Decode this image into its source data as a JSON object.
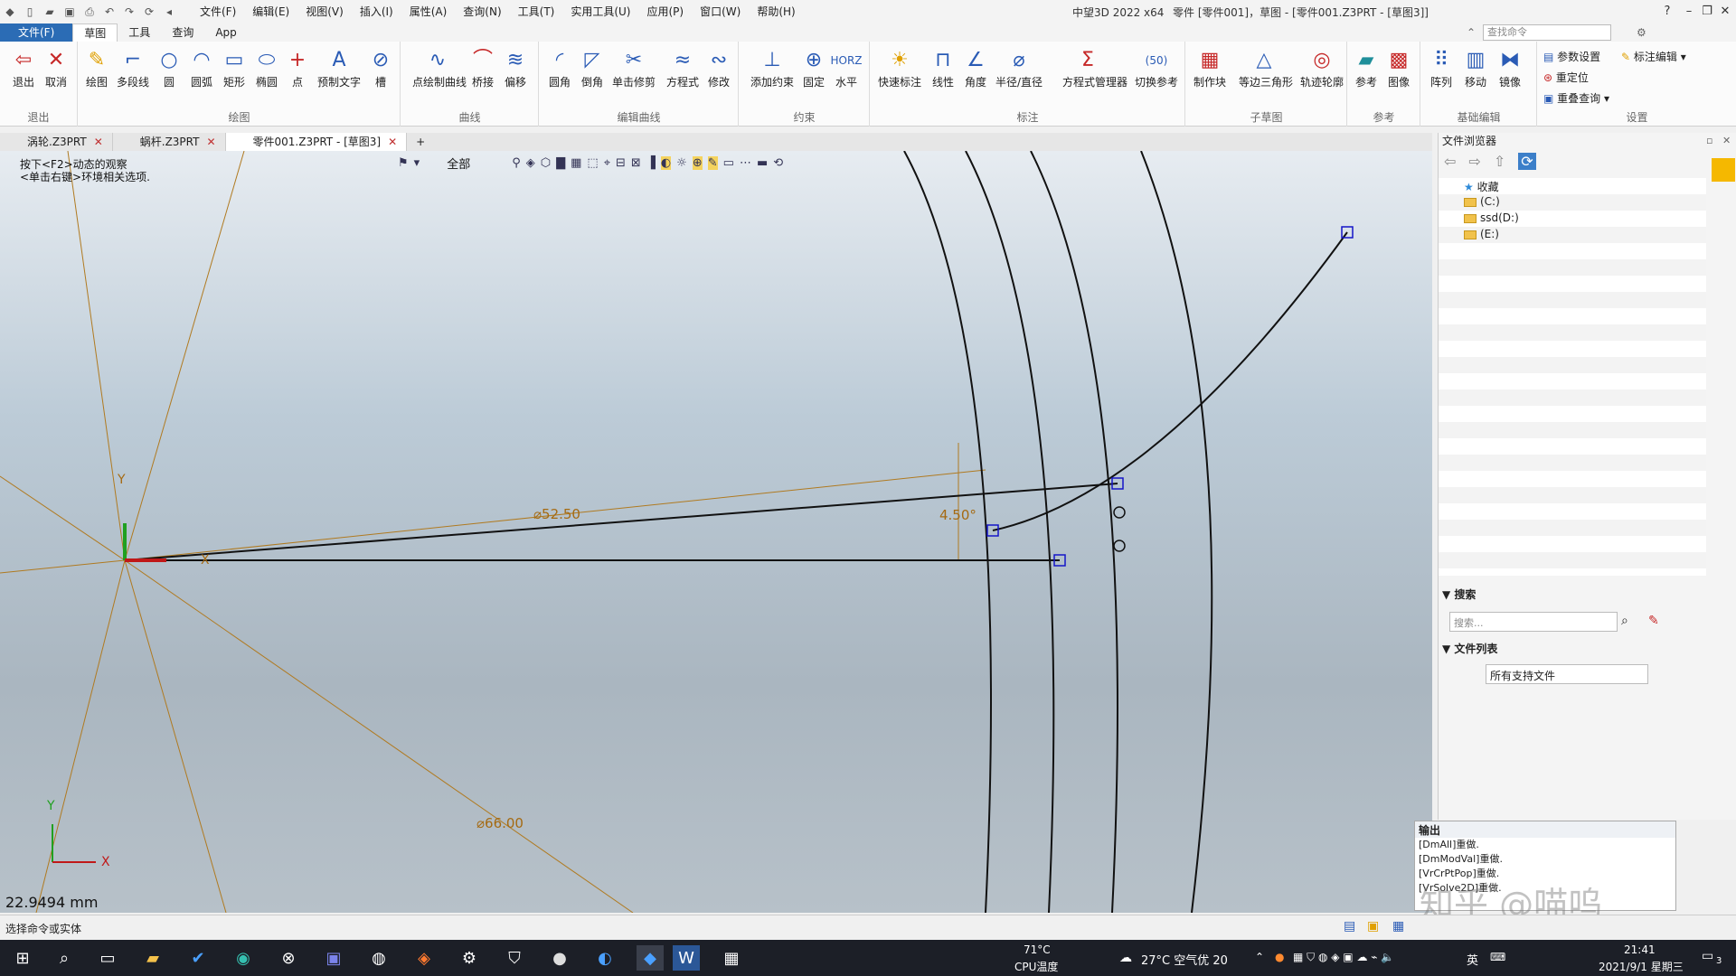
{
  "titlebar": {
    "menu": [
      "文件(F)",
      "编辑(E)",
      "视图(V)",
      "插入(I)",
      "属性(A)",
      "查询(N)",
      "工具(T)",
      "实用工具(U)",
      "应用(P)",
      "窗口(W)",
      "帮助(H)"
    ],
    "app_name": "中望3D 2022 x64",
    "doc_title": "零件 [零件001]，草图 - [零件001.Z3PRT - [草图3]]"
  },
  "ribbon_tabs": [
    "文件(F)",
    "草图",
    "工具",
    "查询",
    "App"
  ],
  "command_search_placeholder": "查找命令",
  "ribbon": {
    "groups": [
      {
        "label": "退出",
        "tools": [
          "退出",
          "取消"
        ]
      },
      {
        "label": "绘图",
        "tools": [
          "绘图",
          "多段线",
          "圆",
          "圆弧",
          "矩形",
          "椭圆",
          "点",
          "预制文字",
          "槽"
        ]
      },
      {
        "label": "曲线",
        "tools": [
          "点绘制曲线",
          "桥接",
          "偏移"
        ]
      },
      {
        "label": "编辑曲线",
        "tools": [
          "圆角",
          "倒角",
          "单击修剪",
          "方程式",
          "修改"
        ]
      },
      {
        "label": "约束",
        "tools": [
          "添加约束",
          "固定",
          "水平"
        ]
      },
      {
        "label": "标注",
        "tools": [
          "快速标注",
          "线性",
          "角度",
          "半径/直径",
          "方程式管理器",
          "切换参考"
        ]
      },
      {
        "label": "子草图",
        "tools": [
          "制作块",
          "等边三角形",
          "轨迹轮廓"
        ]
      },
      {
        "label": "参考",
        "tools": [
          "参考",
          "图像"
        ]
      },
      {
        "label": "基础编辑",
        "tools": [
          "阵列",
          "移动",
          "镜像"
        ]
      },
      {
        "label": "设置",
        "tools": [
          "参数设置",
          "重定位",
          "重叠查询",
          "标注编辑"
        ]
      }
    ]
  },
  "doc_tabs": [
    "涡轮.Z3PRT",
    "蜗杆.Z3PRT",
    "零件001.Z3PRT - [草图3]"
  ],
  "viewport": {
    "hint1": "按下<F2>动态的观察",
    "hint2": "<单击右键>环境相关选项.",
    "toolbar_filter": "全部",
    "dim_radius1": "⌀52.50",
    "dim_radius2": "⌀66.00",
    "dim_angle": "4.50°",
    "axis_x": "X",
    "axis_y": "Y",
    "measure": "22.9494 mm"
  },
  "file_browser": {
    "title": "文件浏览器",
    "tree": [
      "收藏",
      "(C:)",
      "ssd(D:)",
      "(E:)"
    ],
    "search_title": "搜索",
    "search_placeholder": "搜索...",
    "file_list_title": "文件列表",
    "file_filter": "所有支持文件"
  },
  "output": {
    "title": "输出",
    "lines": [
      "[DmAll]重做.",
      "[DmModVal]重做.",
      "[VrCrPtPop]重做.",
      "[VrSolve2D]重做."
    ]
  },
  "status": "选择命令或实体",
  "watermark": "知乎 @喵呜",
  "taskbar": {
    "cpu_temp": "71°C",
    "cpu_label": "CPU温度",
    "weather": "27°C 空气优 20",
    "ime": "英",
    "time": "21:41",
    "date": "2021/9/1 星期三",
    "notif_count": "3"
  }
}
